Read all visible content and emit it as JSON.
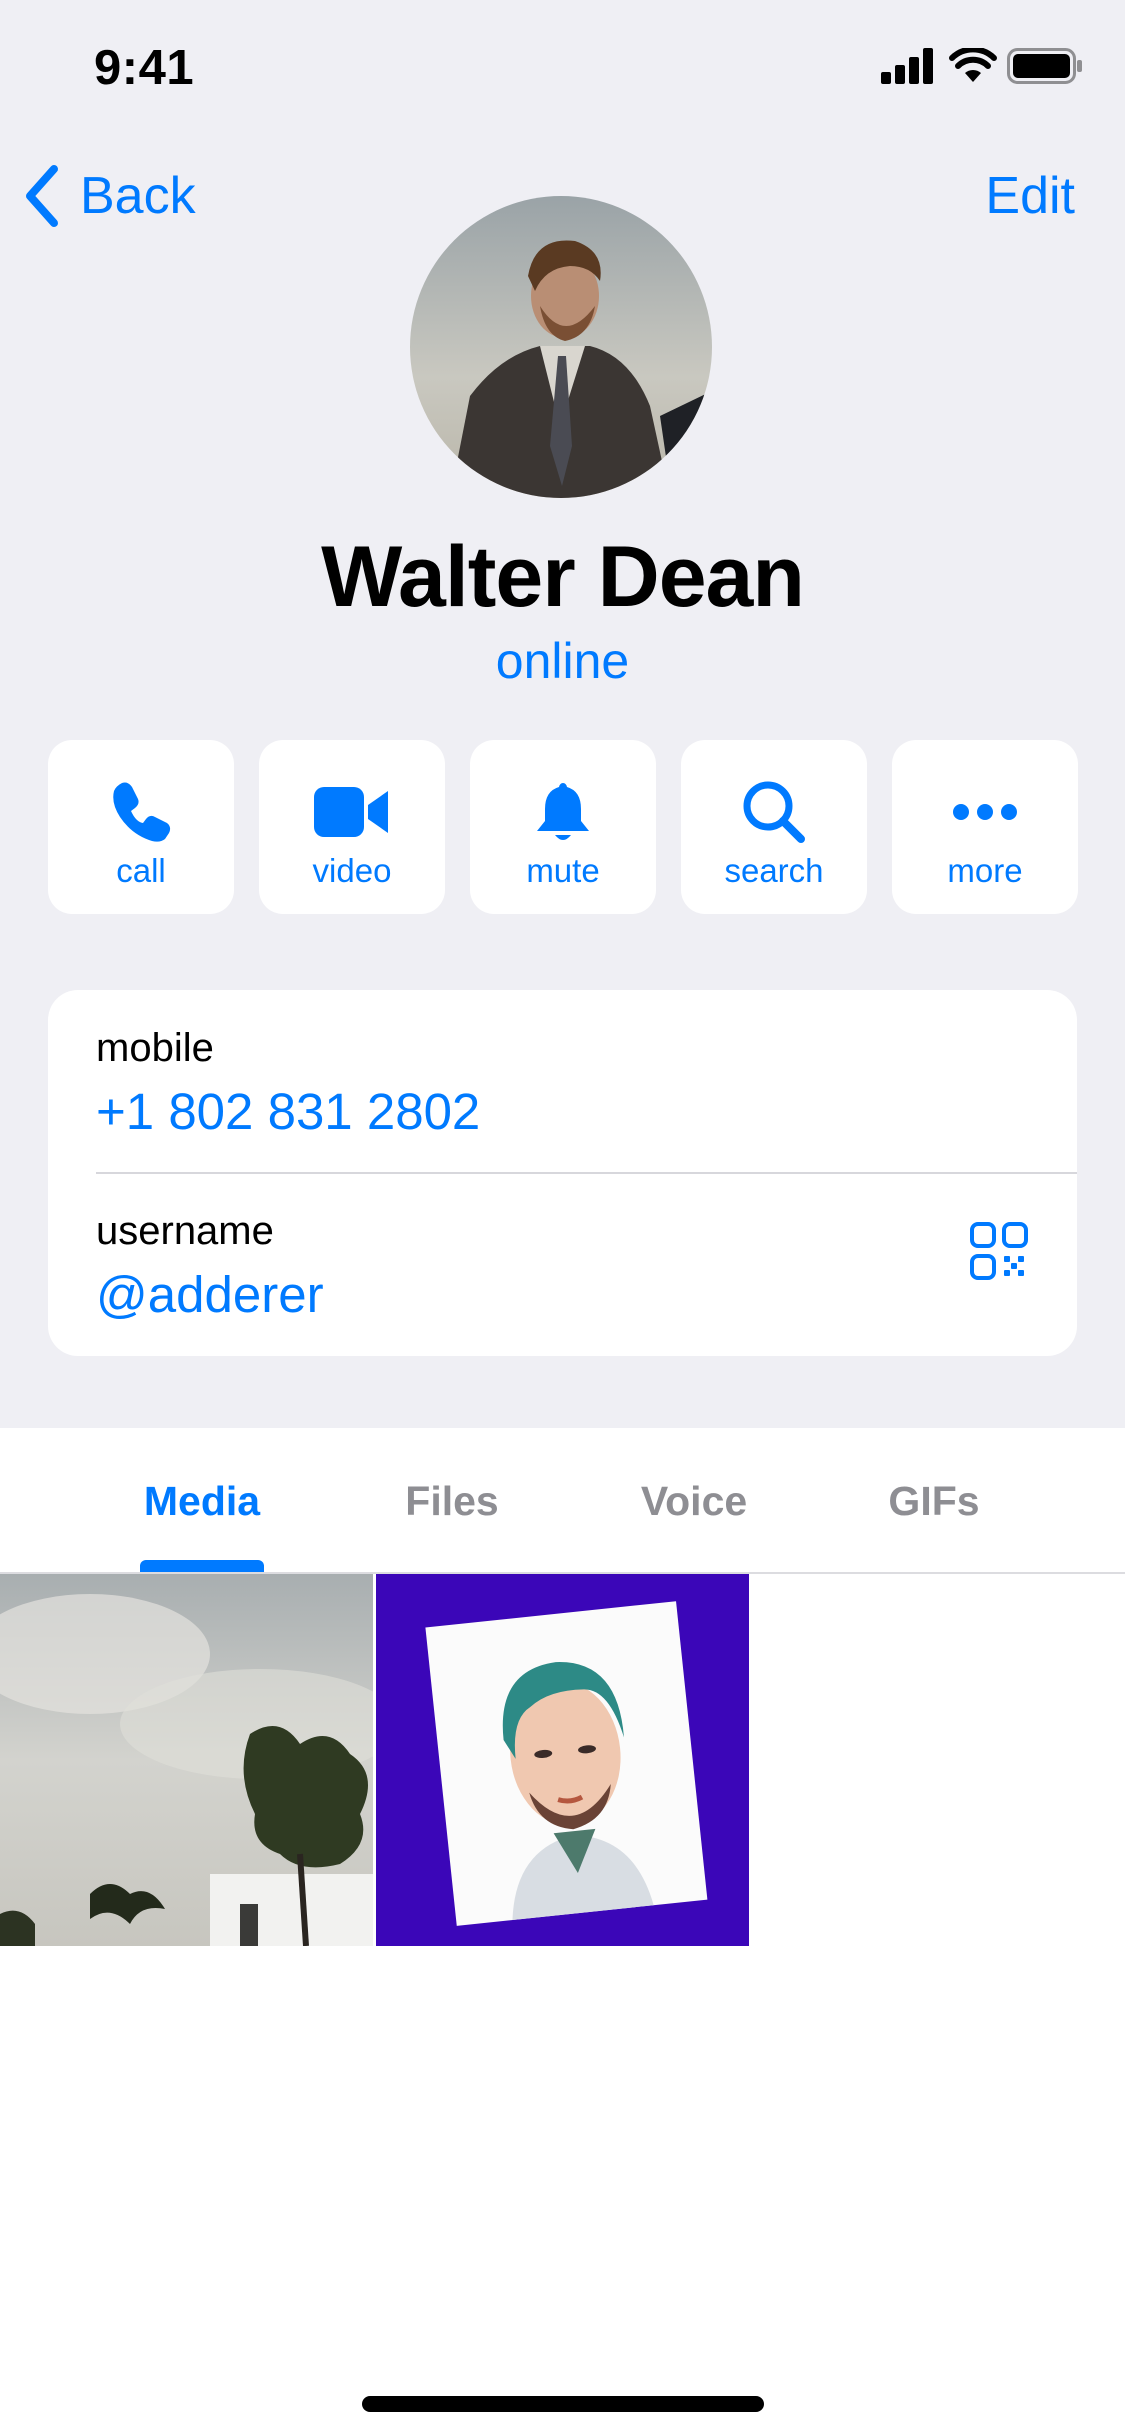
{
  "status_bar": {
    "time": "9:41"
  },
  "nav": {
    "back_label": "Back",
    "edit_label": "Edit"
  },
  "profile": {
    "name": "Walter Dean",
    "status": "online"
  },
  "actions": [
    {
      "label": "call",
      "icon": "phone-icon"
    },
    {
      "label": "video",
      "icon": "video-camera-icon"
    },
    {
      "label": "mute",
      "icon": "bell-icon"
    },
    {
      "label": "search",
      "icon": "search-icon"
    },
    {
      "label": "more",
      "icon": "ellipsis-icon"
    }
  ],
  "info": {
    "mobile_label": "mobile",
    "mobile_value": "+1 802 831 2802",
    "username_label": "username",
    "username_value": "@adderer"
  },
  "tabs": [
    {
      "label": "Media",
      "active": true
    },
    {
      "label": "Files",
      "active": false
    },
    {
      "label": "Voice",
      "active": false
    },
    {
      "label": "GIFs",
      "active": false
    }
  ],
  "colors": {
    "accent": "#007aff",
    "background": "#efeff4",
    "card": "#ffffff"
  }
}
